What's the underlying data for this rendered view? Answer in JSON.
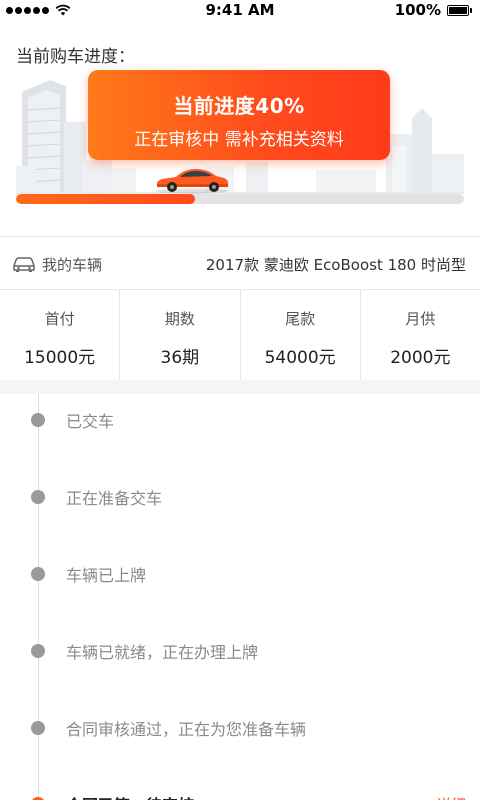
{
  "status_bar": {
    "time": "9:41 AM",
    "battery": "100%"
  },
  "progress": {
    "title": "当前购车进度：",
    "headline": "当前进度40%",
    "status": "正在审核中 需补充相关资料",
    "percent": 0.4
  },
  "vehicle": {
    "label": "我的车辆",
    "model": "2017款 蒙迪欧 EcoBoost 180 时尚型"
  },
  "payment": [
    {
      "label": "首付",
      "value": "15000元"
    },
    {
      "label": "期数",
      "value": "36期"
    },
    {
      "label": "尾款",
      "value": "54000元"
    },
    {
      "label": "月供",
      "value": "2000元"
    }
  ],
  "timeline": [
    {
      "text": "已交车",
      "active": false
    },
    {
      "text": "正在准备交车",
      "active": false
    },
    {
      "text": "车辆已上牌",
      "active": false
    },
    {
      "text": "车辆已就绪，正在办理上牌",
      "active": false
    },
    {
      "text": "合同审核通过，正在为您准备车辆",
      "active": false
    },
    {
      "text": "合同已签，待审核",
      "active": true,
      "action": "详细"
    }
  ],
  "colors": {
    "accent": "#ff5a1f",
    "inactive_dot": "#9a9a9a"
  }
}
